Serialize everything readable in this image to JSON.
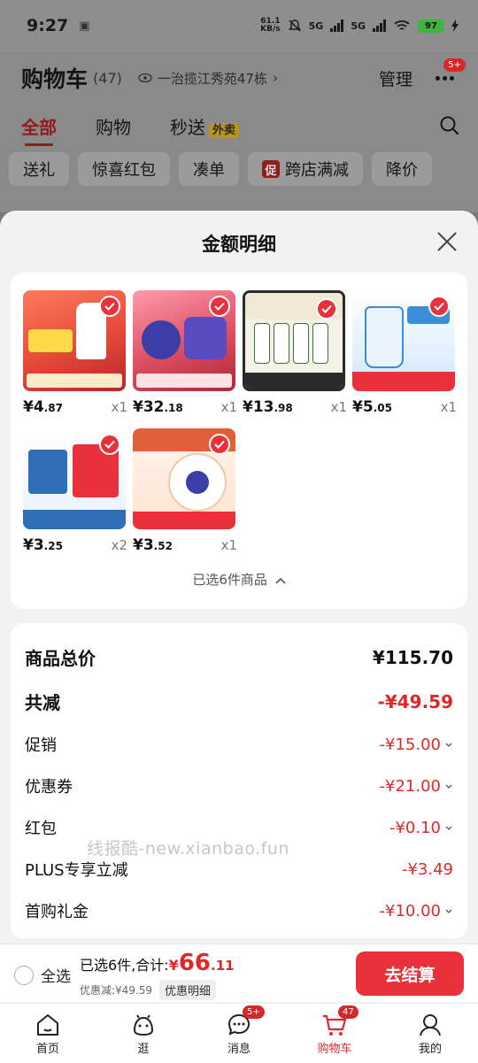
{
  "status_bar": {
    "time": "9:27",
    "speed": "61.1\nKB/s",
    "net1": "5G",
    "net2": "5G",
    "battery": "97"
  },
  "header": {
    "title": "购物车",
    "count": "(47)",
    "address": "一治揽江秀苑47栋",
    "manage": "管理",
    "more_badge": "5+"
  },
  "tabs": [
    {
      "label": "全部"
    },
    {
      "label": "购物"
    },
    {
      "label": "秒送",
      "tag": "外卖"
    }
  ],
  "filters": [
    {
      "label": "送礼"
    },
    {
      "label": "惊喜红包"
    },
    {
      "label": "凑单"
    },
    {
      "label": "跨店满减",
      "tag": "促"
    },
    {
      "label": "降价"
    }
  ],
  "sheet": {
    "title": "金额明细",
    "products": [
      {
        "price_int": "¥4",
        "price_dec": ".87",
        "qty": "x1",
        "color": "#e54a3a"
      },
      {
        "price_int": "¥32",
        "price_dec": ".18",
        "qty": "x1",
        "color": "#d9495c"
      },
      {
        "price_int": "¥13",
        "price_dec": ".98",
        "qty": "x1",
        "color": "#3c6e3f"
      },
      {
        "price_int": "¥5",
        "price_dec": ".05",
        "qty": "x1",
        "color": "#3a8fd6"
      },
      {
        "price_int": "¥3",
        "price_dec": ".25",
        "qty": "x2",
        "color": "#2f6fb8"
      },
      {
        "price_int": "¥3",
        "price_dec": ".52",
        "qty": "x1",
        "color": "#e0603a"
      }
    ],
    "selected_summary": "已选6件商品",
    "breakdown": {
      "total_label": "商品总价",
      "total_value": "¥115.70",
      "discount_label": "共减",
      "discount_value": "-¥49.59",
      "promo_label": "促销",
      "promo_value": "-¥15.00",
      "coupon_label": "优惠券",
      "coupon_value": "-¥21.00",
      "redpacket_label": "红包",
      "redpacket_value": "-¥0.10",
      "plus_label": "PLUS专享立减",
      "plus_value": "-¥3.49",
      "first_label": "首购礼金",
      "first_value": "-¥10.00"
    },
    "watermark": "线报酷-new.xianbao.fun"
  },
  "checkout": {
    "select_all": "全选",
    "summary_prefix": "已选6件,合计:",
    "currency": "¥",
    "total_int": "66",
    "total_dec": ".11",
    "saved": "优惠减:¥49.59",
    "detail": "优惠明细",
    "button": "去结算"
  },
  "nav": [
    {
      "label": "首页"
    },
    {
      "label": "逛"
    },
    {
      "label": "消息",
      "badge": "5+"
    },
    {
      "label": "购物车",
      "badge": "47"
    },
    {
      "label": "我的"
    }
  ],
  "colors": {
    "accent": "#e8313a",
    "price_red": "#e02828"
  }
}
